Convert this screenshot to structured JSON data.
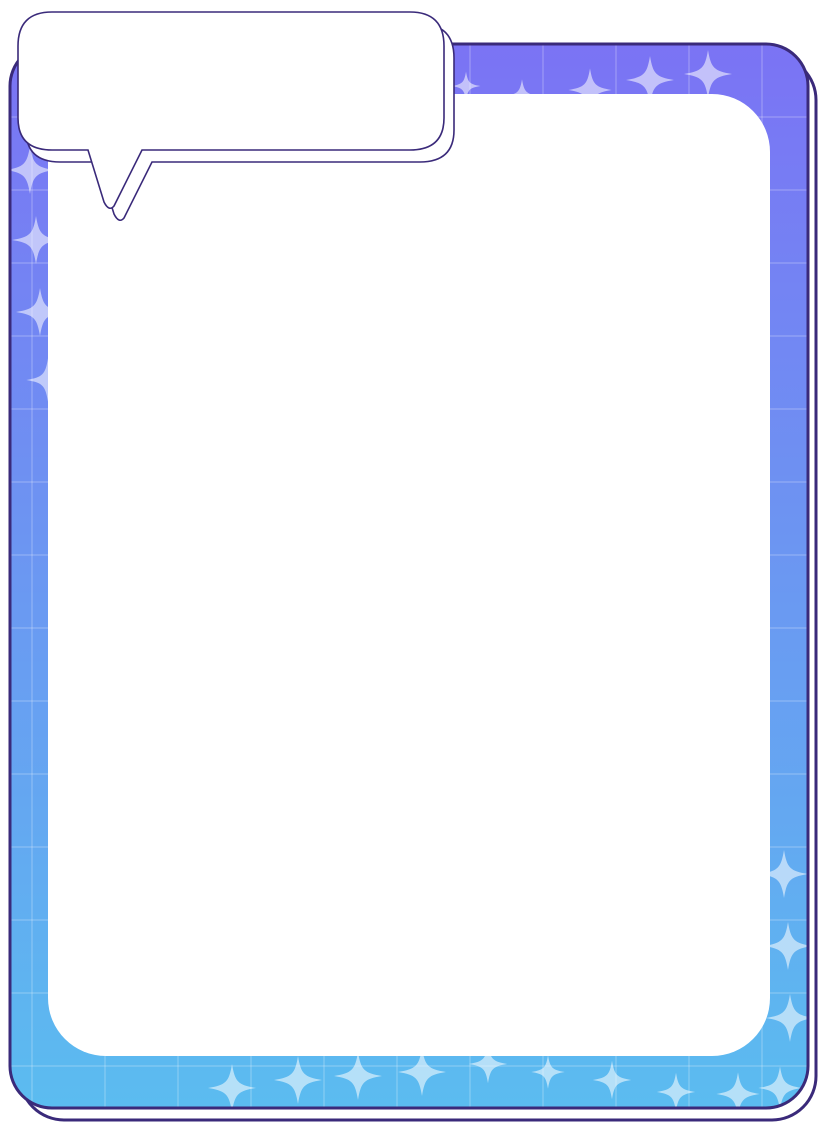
{
  "frame": {
    "gradient_top_color": "#7b73f4",
    "gradient_bottom_color": "#5bbcf0",
    "outline_color": "#3a2a7a",
    "grid_line_color": "#ffffff",
    "sparkle_color": "#ffffff",
    "content_panel_color": "#ffffff"
  },
  "speech_bubble": {
    "fill_color": "#ffffff",
    "outline_color": "#3a2a7a",
    "text": ""
  }
}
